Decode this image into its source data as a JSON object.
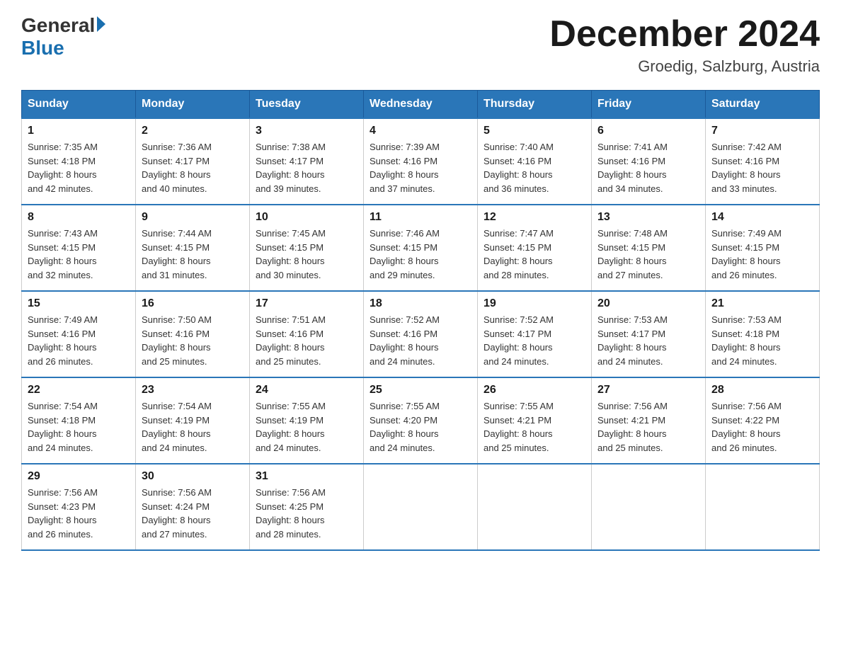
{
  "header": {
    "logo_general": "General",
    "logo_blue": "Blue",
    "month_title": "December 2024",
    "location": "Groedig, Salzburg, Austria"
  },
  "weekdays": [
    "Sunday",
    "Monday",
    "Tuesday",
    "Wednesday",
    "Thursday",
    "Friday",
    "Saturday"
  ],
  "days": [
    {
      "date": "1",
      "sunrise": "7:35 AM",
      "sunset": "4:18 PM",
      "daylight": "8 hours and 42 minutes."
    },
    {
      "date": "2",
      "sunrise": "7:36 AM",
      "sunset": "4:17 PM",
      "daylight": "8 hours and 40 minutes."
    },
    {
      "date": "3",
      "sunrise": "7:38 AM",
      "sunset": "4:17 PM",
      "daylight": "8 hours and 39 minutes."
    },
    {
      "date": "4",
      "sunrise": "7:39 AM",
      "sunset": "4:16 PM",
      "daylight": "8 hours and 37 minutes."
    },
    {
      "date": "5",
      "sunrise": "7:40 AM",
      "sunset": "4:16 PM",
      "daylight": "8 hours and 36 minutes."
    },
    {
      "date": "6",
      "sunrise": "7:41 AM",
      "sunset": "4:16 PM",
      "daylight": "8 hours and 34 minutes."
    },
    {
      "date": "7",
      "sunrise": "7:42 AM",
      "sunset": "4:16 PM",
      "daylight": "8 hours and 33 minutes."
    },
    {
      "date": "8",
      "sunrise": "7:43 AM",
      "sunset": "4:15 PM",
      "daylight": "8 hours and 32 minutes."
    },
    {
      "date": "9",
      "sunrise": "7:44 AM",
      "sunset": "4:15 PM",
      "daylight": "8 hours and 31 minutes."
    },
    {
      "date": "10",
      "sunrise": "7:45 AM",
      "sunset": "4:15 PM",
      "daylight": "8 hours and 30 minutes."
    },
    {
      "date": "11",
      "sunrise": "7:46 AM",
      "sunset": "4:15 PM",
      "daylight": "8 hours and 29 minutes."
    },
    {
      "date": "12",
      "sunrise": "7:47 AM",
      "sunset": "4:15 PM",
      "daylight": "8 hours and 28 minutes."
    },
    {
      "date": "13",
      "sunrise": "7:48 AM",
      "sunset": "4:15 PM",
      "daylight": "8 hours and 27 minutes."
    },
    {
      "date": "14",
      "sunrise": "7:49 AM",
      "sunset": "4:15 PM",
      "daylight": "8 hours and 26 minutes."
    },
    {
      "date": "15",
      "sunrise": "7:49 AM",
      "sunset": "4:16 PM",
      "daylight": "8 hours and 26 minutes."
    },
    {
      "date": "16",
      "sunrise": "7:50 AM",
      "sunset": "4:16 PM",
      "daylight": "8 hours and 25 minutes."
    },
    {
      "date": "17",
      "sunrise": "7:51 AM",
      "sunset": "4:16 PM",
      "daylight": "8 hours and 25 minutes."
    },
    {
      "date": "18",
      "sunrise": "7:52 AM",
      "sunset": "4:16 PM",
      "daylight": "8 hours and 24 minutes."
    },
    {
      "date": "19",
      "sunrise": "7:52 AM",
      "sunset": "4:17 PM",
      "daylight": "8 hours and 24 minutes."
    },
    {
      "date": "20",
      "sunrise": "7:53 AM",
      "sunset": "4:17 PM",
      "daylight": "8 hours and 24 minutes."
    },
    {
      "date": "21",
      "sunrise": "7:53 AM",
      "sunset": "4:18 PM",
      "daylight": "8 hours and 24 minutes."
    },
    {
      "date": "22",
      "sunrise": "7:54 AM",
      "sunset": "4:18 PM",
      "daylight": "8 hours and 24 minutes."
    },
    {
      "date": "23",
      "sunrise": "7:54 AM",
      "sunset": "4:19 PM",
      "daylight": "8 hours and 24 minutes."
    },
    {
      "date": "24",
      "sunrise": "7:55 AM",
      "sunset": "4:19 PM",
      "daylight": "8 hours and 24 minutes."
    },
    {
      "date": "25",
      "sunrise": "7:55 AM",
      "sunset": "4:20 PM",
      "daylight": "8 hours and 24 minutes."
    },
    {
      "date": "26",
      "sunrise": "7:55 AM",
      "sunset": "4:21 PM",
      "daylight": "8 hours and 25 minutes."
    },
    {
      "date": "27",
      "sunrise": "7:56 AM",
      "sunset": "4:21 PM",
      "daylight": "8 hours and 25 minutes."
    },
    {
      "date": "28",
      "sunrise": "7:56 AM",
      "sunset": "4:22 PM",
      "daylight": "8 hours and 26 minutes."
    },
    {
      "date": "29",
      "sunrise": "7:56 AM",
      "sunset": "4:23 PM",
      "daylight": "8 hours and 26 minutes."
    },
    {
      "date": "30",
      "sunrise": "7:56 AM",
      "sunset": "4:24 PM",
      "daylight": "8 hours and 27 minutes."
    },
    {
      "date": "31",
      "sunrise": "7:56 AM",
      "sunset": "4:25 PM",
      "daylight": "8 hours and 28 minutes."
    }
  ],
  "labels": {
    "sunrise": "Sunrise:",
    "sunset": "Sunset:",
    "daylight": "Daylight:"
  }
}
